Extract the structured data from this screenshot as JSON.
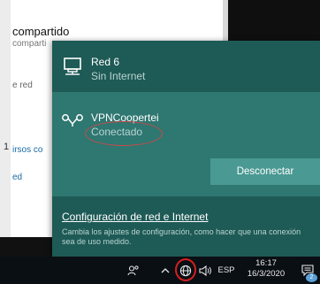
{
  "background": {
    "title": "compartido",
    "subtitle": "comparti",
    "red_text": "e red",
    "bullet": "1",
    "link_text": "irsos co",
    "link2_text": "ed"
  },
  "flyout": {
    "networks": [
      {
        "name": "Red 6",
        "status": "Sin Internet",
        "icon": "ethernet-icon"
      },
      {
        "name": "VPNCoopertei",
        "status": "Conectado",
        "icon": "vpn-icon"
      }
    ],
    "disconnect_label": "Desconectar",
    "settings_link": "Configuración de red e Internet",
    "settings_desc": "Cambia los ajustes de configuración, como hacer que una conexión sea de uso medido."
  },
  "taskbar": {
    "language": "ESP",
    "time": "16:17",
    "date": "16/3/2020",
    "notification_count": "2",
    "icons": [
      "people-icon",
      "chevron-up-icon",
      "network-globe-icon",
      "volume-icon",
      "notification-icon"
    ]
  },
  "colors": {
    "flyout_bg": "#1e5a56",
    "selected_bg": "#2f7771",
    "button_bg": "#4a9993",
    "annotation_red": "#c94a4a"
  }
}
